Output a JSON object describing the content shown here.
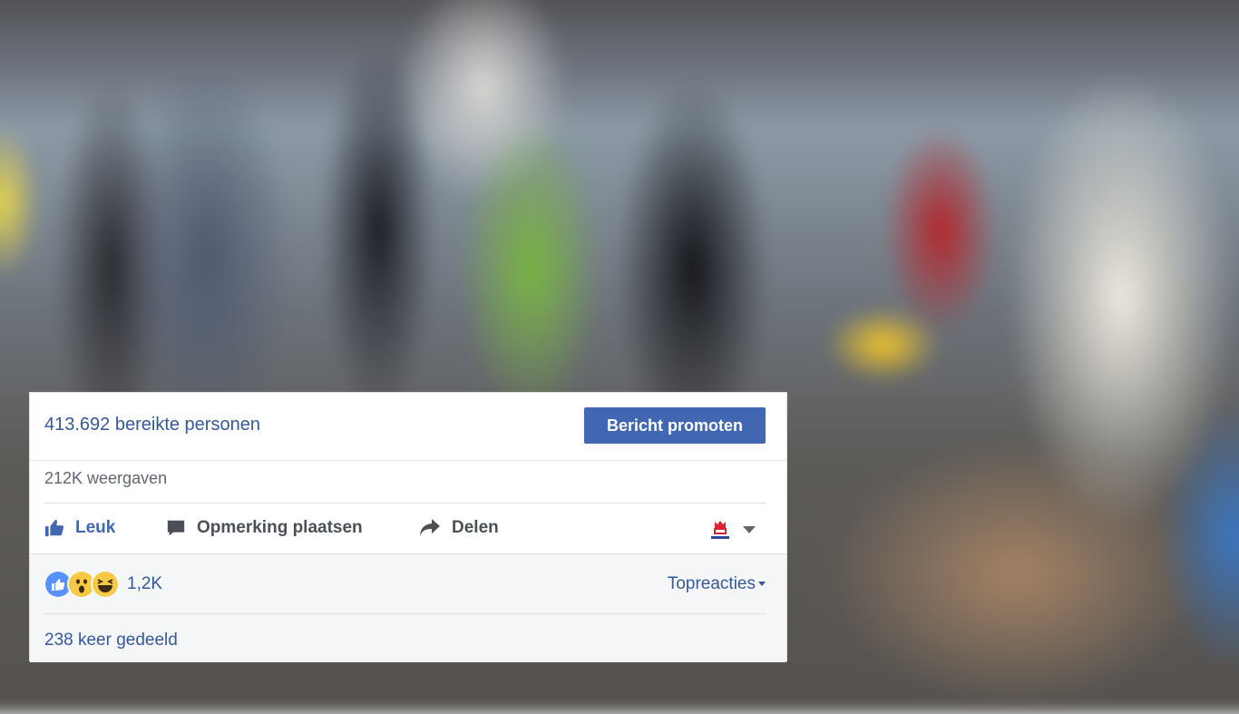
{
  "post_insights": {
    "reach_text": "413.692 bereikte personen",
    "promote_button": "Bericht promoten",
    "views_text": "212K weergaven"
  },
  "actions": {
    "like_label": "Leuk",
    "comment_label": "Opmerking plaatsen",
    "share_label": "Delen"
  },
  "reactions": {
    "icons": [
      "like-icon",
      "wow-icon",
      "haha-icon"
    ],
    "count": "1,2K",
    "sort_label": "Topreacties"
  },
  "shares_text": "238 keer gedeeld",
  "colors": {
    "brand_blue": "#4267b2",
    "link_blue": "#365899",
    "text_gray": "#606770"
  }
}
